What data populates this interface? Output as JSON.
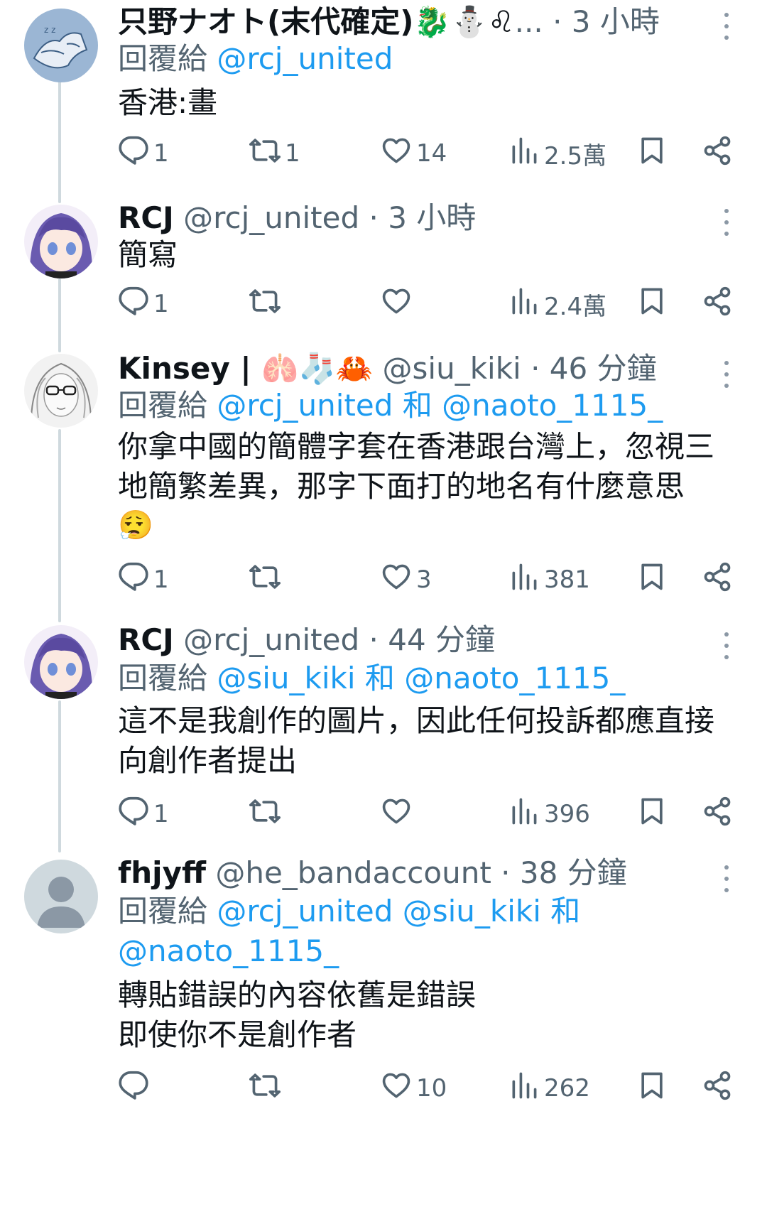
{
  "reply_prefix": "回覆給",
  "and_word": "和",
  "separator": "·",
  "tweets": [
    {
      "name": "只野ナオト(末代確定)🐉⛄♌",
      "ellipsis": "...",
      "time": "3 小時",
      "reply_mentions": [
        "@rcj_united"
      ],
      "body": [
        "香港:畫"
      ],
      "stats": {
        "replies": "1",
        "retweets": "1",
        "likes": "14",
        "views": "2.5萬"
      },
      "avatar": "wolf-sketch-avatar"
    },
    {
      "name": "RCJ",
      "handle": "@rcj_united",
      "time": "3 小時",
      "body": [
        "簡寫"
      ],
      "stats": {
        "replies": "1",
        "retweets": "",
        "likes": "",
        "views": "2.4萬"
      },
      "avatar": "purple-hair-anime-avatar"
    },
    {
      "name": "Kinsey | 🫁🧦🦀",
      "handle": "@siu_kiki",
      "time": "46 分鐘",
      "reply_mentions": [
        "@rcj_united",
        "@naoto_1115_"
      ],
      "body": [
        "你拿中國的簡體字套在香港跟台灣上，忽視三",
        "地簡繁差異，那字下面打的地名有什麼意思",
        "😮‍💨"
      ],
      "stats": {
        "replies": "1",
        "retweets": "",
        "likes": "3",
        "views": "381"
      },
      "avatar": "sketch-girl-glasses-avatar"
    },
    {
      "name": "RCJ",
      "handle": "@rcj_united",
      "time": "44 分鐘",
      "reply_mentions": [
        "@siu_kiki",
        "@naoto_1115_"
      ],
      "body": [
        "這不是我創作的圖片，因此任何投訴都應直接",
        "向創作者提出"
      ],
      "stats": {
        "replies": "1",
        "retweets": "",
        "likes": "",
        "views": "396"
      },
      "avatar": "purple-hair-anime-avatar"
    },
    {
      "name": "fhjyff",
      "handle": "@he_bandaccount",
      "time": "38 分鐘",
      "reply_mentions": [
        "@rcj_united",
        "@siu_kiki",
        "@naoto_1115_"
      ],
      "body": [
        "轉貼錯誤的內容依舊是錯誤",
        "即使你不是創作者"
      ],
      "stats": {
        "replies": "",
        "retweets": "",
        "likes": "10",
        "views": "262"
      },
      "avatar": "default-profile-avatar"
    }
  ],
  "icons": {
    "reply": "reply-icon",
    "retweet": "retweet-icon",
    "like": "like-icon",
    "views": "views-icon",
    "bookmark": "bookmark-icon",
    "share": "share-icon",
    "more": "more-icon"
  },
  "colors": {
    "text": "#0f1419",
    "secondary": "#536471",
    "link": "#1d9bf0",
    "thread_line": "#cfd9de"
  }
}
